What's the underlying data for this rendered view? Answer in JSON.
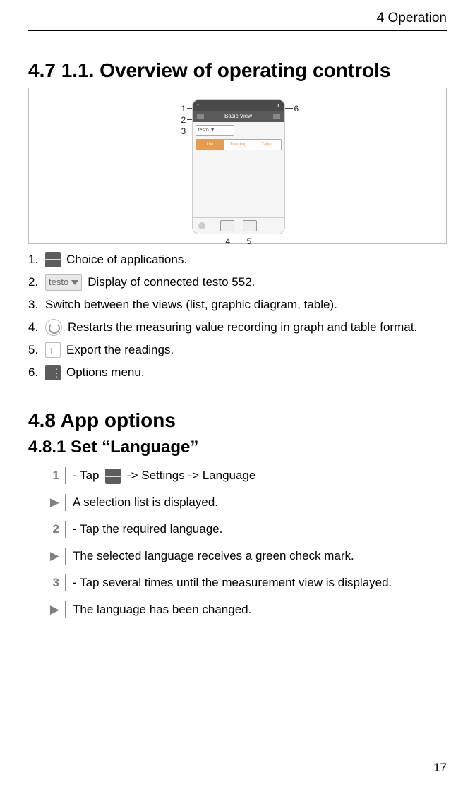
{
  "header": {
    "chapter": "4 Operation"
  },
  "section47": {
    "heading": "4.7  1.1.   Overview of operating controls",
    "figure": {
      "title": "Basic View",
      "dropdown": "testo ▼",
      "tabs": [
        "List",
        "Trending",
        "Table"
      ],
      "callouts": {
        "c1": "1",
        "c2": "2",
        "c3": "3",
        "c4": "4",
        "c5": "5",
        "c6": "6"
      }
    },
    "items": [
      {
        "n": "1.",
        "text": "Choice of applications."
      },
      {
        "n": "2.",
        "badge": "testo",
        "text": "Display of connected testo 552."
      },
      {
        "n": "3.",
        "text": "Switch between the views (list, graphic diagram, table)."
      },
      {
        "n": "4.",
        "text": "Restarts the measuring value recording in graph and table format."
      },
      {
        "n": "5.",
        "text": "Export the readings."
      },
      {
        "n": "6.",
        "text": "Options menu."
      }
    ]
  },
  "section48": {
    "heading": "4.8  App options",
    "subheading": "4.8.1  Set “Language”",
    "steps": [
      {
        "marker": "1",
        "type": "num",
        "pre": "- Tap ",
        "post": " -> Settings -> Language",
        "icon": true
      },
      {
        "marker": "▶",
        "type": "arrow",
        "text": "A selection list is displayed."
      },
      {
        "marker": "2",
        "type": "num",
        "text": "- Tap the required language."
      },
      {
        "marker": "▶",
        "type": "arrow",
        "text": "The selected language receives a green check mark."
      },
      {
        "marker": "3",
        "type": "num",
        "text": "- Tap   several times until the measurement view is displayed."
      },
      {
        "marker": "▶",
        "type": "arrow",
        "text": "The language has been changed."
      }
    ]
  },
  "page_number": "17"
}
